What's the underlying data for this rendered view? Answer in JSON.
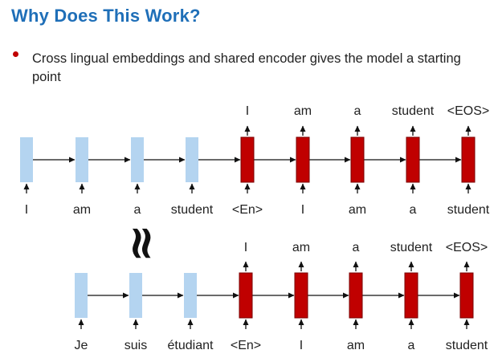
{
  "slide": {
    "title": "Why Does This Work?",
    "bullet": "Cross lingual embeddings and shared encoder gives the model a starting point"
  },
  "colors": {
    "title": "#1f6fb8",
    "bullet": "#c00000",
    "encoder_block": "#b4d4f0",
    "decoder_block": "#c00000",
    "decoder_border": "#7a0000",
    "arrow": "#111111"
  },
  "symbols": {
    "approx": "≈"
  },
  "rows": [
    {
      "id": "top",
      "encoder_inputs": [
        "I",
        "am",
        "a",
        "student"
      ],
      "decoder_inputs": [
        "<En>",
        "I",
        "am",
        "a",
        "student"
      ],
      "decoder_outputs": [
        "I",
        "am",
        "a",
        "student",
        "<EOS>"
      ]
    },
    {
      "id": "bottom",
      "encoder_inputs": [
        "Je",
        "suis",
        "étudiant"
      ],
      "decoder_inputs": [
        "<En>",
        "I",
        "am",
        "a",
        "student"
      ],
      "decoder_outputs": [
        "I",
        "am",
        "a",
        "student",
        "<EOS>"
      ]
    }
  ]
}
